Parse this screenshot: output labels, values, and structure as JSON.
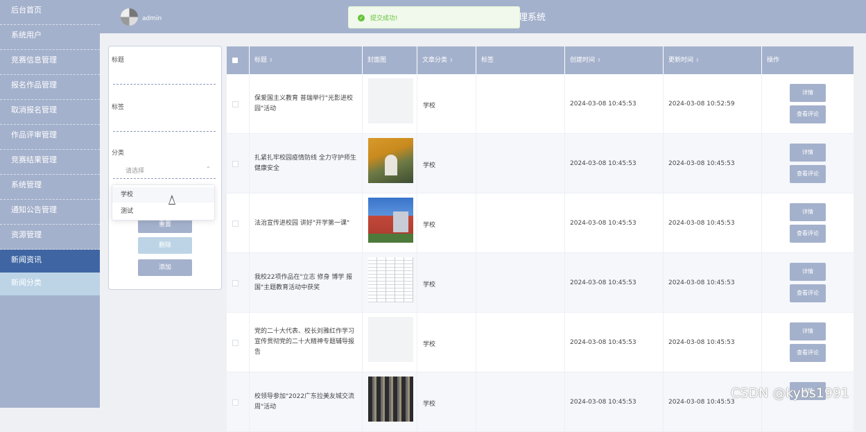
{
  "sidebar": {
    "items": [
      {
        "label": "后台首页"
      },
      {
        "label": "系统用户"
      },
      {
        "label": "竞赛信息管理"
      },
      {
        "label": "报名作品管理"
      },
      {
        "label": "取消报名管理"
      },
      {
        "label": "作品评审管理"
      },
      {
        "label": "竞赛结果管理"
      },
      {
        "label": "系统管理"
      },
      {
        "label": "通知公告管理"
      },
      {
        "label": "资源管理"
      },
      {
        "label": "新闻资讯"
      },
      {
        "label": "新闻分类"
      }
    ],
    "active_color": "#3f66a3"
  },
  "header": {
    "user_name": "admin",
    "title_fragment": "理系统"
  },
  "toast": {
    "icon": "check-icon",
    "message": "提交成功!",
    "color": "#67c23a"
  },
  "search": {
    "title_label": "标题",
    "tag_label": "标签",
    "category_label": "分类",
    "category_placeholder": "请选择",
    "dropdown_options": [
      "学校",
      "测试"
    ],
    "reset_label": "重置",
    "delete_label": "删除",
    "add_label": "添加"
  },
  "table": {
    "columns": {
      "title": "标题",
      "cover": "封面图",
      "category": "文章分类",
      "tags": "标签",
      "created": "创建时间",
      "updated": "更新时间",
      "actions": "操作"
    },
    "detail_label": "详情",
    "comments_label": "查看评论",
    "rows": [
      {
        "title": "保爱国主义教育 普瑞举行\"光影进校园\"活动",
        "category": "学校",
        "tags": "",
        "created": "2024-03-08 10:45:53",
        "updated": "2024-03-08 10:52:59",
        "cover": "blank"
      },
      {
        "title": "扎紧扎牢校园疫情防线 全力守护师生健康安全",
        "category": "学校",
        "tags": "",
        "created": "2024-03-08 10:45:53",
        "updated": "2024-03-08 10:45:53",
        "cover": "autumn-campus-photo"
      },
      {
        "title": "法治宣传进校园 讲好\"开学第一课\"",
        "category": "学校",
        "tags": "",
        "created": "2024-03-08 10:45:53",
        "updated": "2024-03-08 10:45:53",
        "cover": "school-building-photo"
      },
      {
        "title": "我校22项作品在\"立志 修身 博学 报国\"主题教育活动中获奖",
        "category": "学校",
        "tags": "",
        "created": "2024-03-08 10:45:53",
        "updated": "2024-03-08 10:45:53",
        "cover": "document-table-image"
      },
      {
        "title": "党的二十大代表、校长刘雅红作学习宣传贯彻党的二十大精神专题辅导报告",
        "category": "学校",
        "tags": "",
        "created": "2024-03-08 10:45:53",
        "updated": "2024-03-08 10:45:53",
        "cover": "blank"
      },
      {
        "title": "校领导参加\"2022广东拉美友城交流周\"活动",
        "category": "学校",
        "tags": "",
        "created": "2024-03-08 10:45:53",
        "updated": "2024-03-08 10:45:53",
        "cover": "event-photo-grid"
      }
    ]
  },
  "watermark": "CSDN @kybs1991"
}
